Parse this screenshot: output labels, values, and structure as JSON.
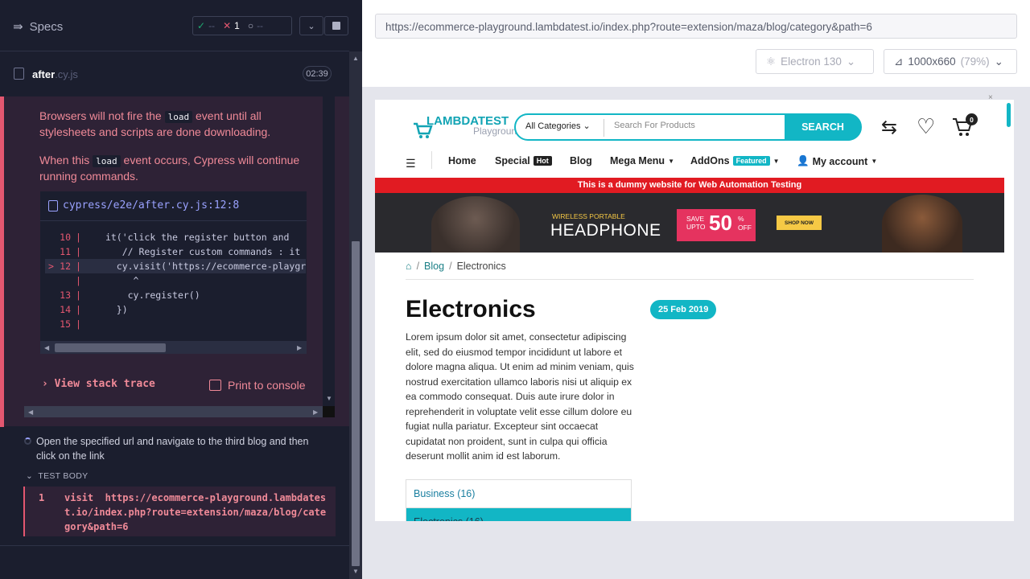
{
  "reporter": {
    "specs_label": "Specs",
    "stats": {
      "passed": "--",
      "failed": "1",
      "pending": "--"
    },
    "file": {
      "name": "after",
      "ext": ".cy.js",
      "time": "02:39"
    },
    "error": {
      "p1_a": "Browsers will not fire the ",
      "p1_code": "load",
      "p1_b": " event until all stylesheets and scripts are done downloading.",
      "p2_a": "When this ",
      "p2_code": "load",
      "p2_b": " event occurs, Cypress will continue running commands.",
      "code_path": "cypress/e2e/after.cy.js:12:8",
      "lines": [
        {
          "num": "10",
          "marker": "",
          "code": "it('click the register button and "
        },
        {
          "num": "11",
          "marker": "",
          "code": "   // Register custom commands : it "
        },
        {
          "num": "12",
          "marker": ">",
          "code": "  cy.visit('https://ecommerce-playgro"
        },
        {
          "num": "",
          "marker": "",
          "code": "     ^"
        },
        {
          "num": "13",
          "marker": "",
          "code": "    cy.register()"
        },
        {
          "num": "14",
          "marker": "",
          "code": "  })"
        },
        {
          "num": "15",
          "marker": "",
          "code": ""
        }
      ],
      "view_stack": "View stack trace",
      "print_console": "Print to console"
    },
    "command": "Open the specified url and navigate to the third blog and then click on the link",
    "test_body_label": "TEST BODY",
    "test_body": {
      "num": "1",
      "cmd": "visit",
      "url": "https://ecommerce-playground.lambdatest.io/index.php?route=extension/maza/blog/category&path=6"
    }
  },
  "aut": {
    "url": "https://ecommerce-playground.lambdatest.io/index.php?route=extension/maza/blog/category&path=6",
    "browser": "Electron 130",
    "viewport": "1000x660",
    "scale": "(79%)"
  },
  "site": {
    "logo_main": "LAMBDATEST",
    "logo_sub": "Playground",
    "category_select": "All Categories",
    "search_placeholder": "Search For Products",
    "search_button": "SEARCH",
    "cart_count": "0",
    "nav": [
      "Home",
      "Special",
      "Blog",
      "Mega Menu",
      "AddOns",
      "My account"
    ],
    "badge_hot": "Hot",
    "badge_featured": "Featured",
    "notice": "This is a dummy website for Web Automation Testing",
    "banner": {
      "small": "WIRELESS PORTABLE",
      "big": "HEADPHONE",
      "save": "SAVE",
      "upto": "UPTO",
      "pct": "50",
      "pctsign": "%",
      "off": "OFF",
      "shop": "SHOP NOW"
    },
    "breadcrumb": [
      "Blog",
      "Electronics"
    ],
    "title": "Electronics",
    "date": "25 Feb 2019",
    "description": "Lorem ipsum dolor sit amet, consectetur adipiscing elit, sed do eiusmod tempor incididunt ut labore et dolore magna aliqua. Ut enim ad minim veniam, quis nostrud exercitation ullamco laboris nisi ut aliquip ex ea commodo consequat. Duis aute irure dolor in reprehenderit in voluptate velit esse cillum dolore eu fugiat nulla pariatur. Excepteur sint occaecat cupidatat non proident, sunt in culpa qui officia deserunt mollit anim id est laborum.",
    "categories": [
      {
        "label": "Business (16)"
      },
      {
        "label": "Electronics (16)"
      }
    ]
  },
  "colors": {
    "accent": "#12b6c5",
    "error": "#e45770",
    "notice": "#e11b22"
  }
}
